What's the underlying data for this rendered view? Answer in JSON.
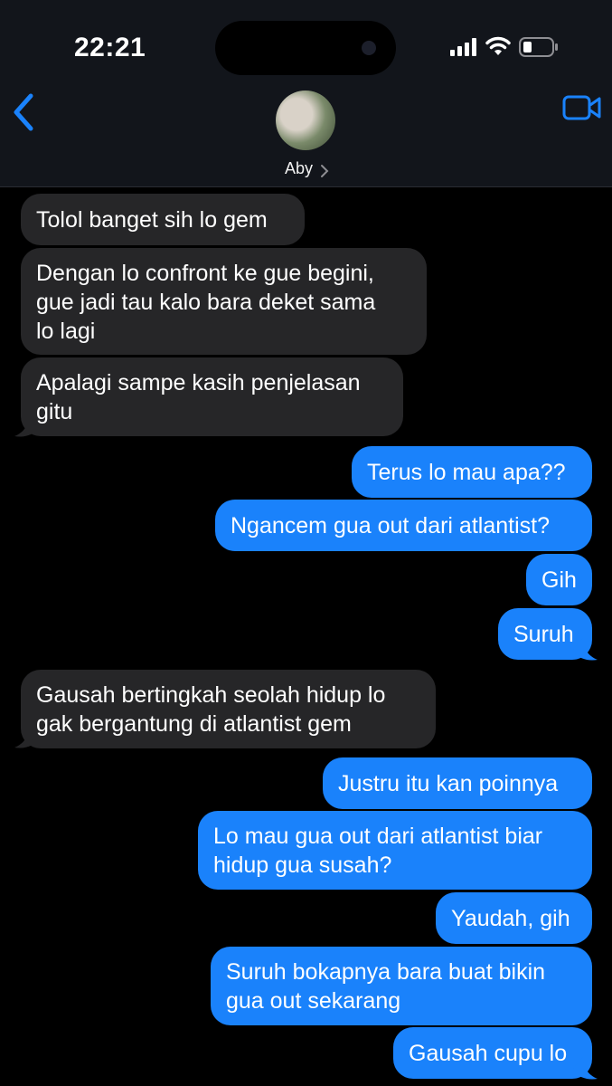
{
  "status_bar": {
    "time": "22:21"
  },
  "header": {
    "contact_name": "Aby"
  },
  "messages": [
    {
      "dir": "in",
      "lines": [
        "Tolol banget sih lo gem"
      ]
    },
    {
      "dir": "in",
      "lines": [
        "Dengan lo confront ke gue begini,",
        "gue jadi tau kalo bara deket sama",
        "lo lagi"
      ]
    },
    {
      "dir": "in",
      "lines": [
        "Apalagi sampe kasih penjelasan",
        "gitu"
      ]
    },
    {
      "dir": "out",
      "lines": [
        "Terus lo mau apa??"
      ]
    },
    {
      "dir": "out",
      "lines": [
        "Ngancem gua out dari atlantist?"
      ]
    },
    {
      "dir": "out",
      "lines": [
        "Gih"
      ]
    },
    {
      "dir": "out",
      "lines": [
        "Suruh"
      ]
    },
    {
      "dir": "in",
      "lines": [
        "Gausah bertingkah seolah hidup lo",
        "gak bergantung di atlantist gem"
      ]
    },
    {
      "dir": "out",
      "lines": [
        "Justru itu kan poinnya"
      ]
    },
    {
      "dir": "out",
      "lines": [
        "Lo mau gua out dari atlantist biar",
        "hidup gua susah?"
      ]
    },
    {
      "dir": "out",
      "lines": [
        "Yaudah, gih"
      ]
    },
    {
      "dir": "out",
      "lines": [
        "Suruh bokapnya bara buat bikin",
        "gua out sekarang"
      ]
    },
    {
      "dir": "out",
      "lines": [
        "Gausah cupu lo"
      ]
    }
  ],
  "colors": {
    "incoming": "#262628",
    "outgoing": "#1a82fb",
    "accent": "#1a82fb"
  },
  "icons": [
    "back-chevron-icon",
    "video-call-icon",
    "signal-icon",
    "wifi-icon",
    "battery-icon"
  ]
}
